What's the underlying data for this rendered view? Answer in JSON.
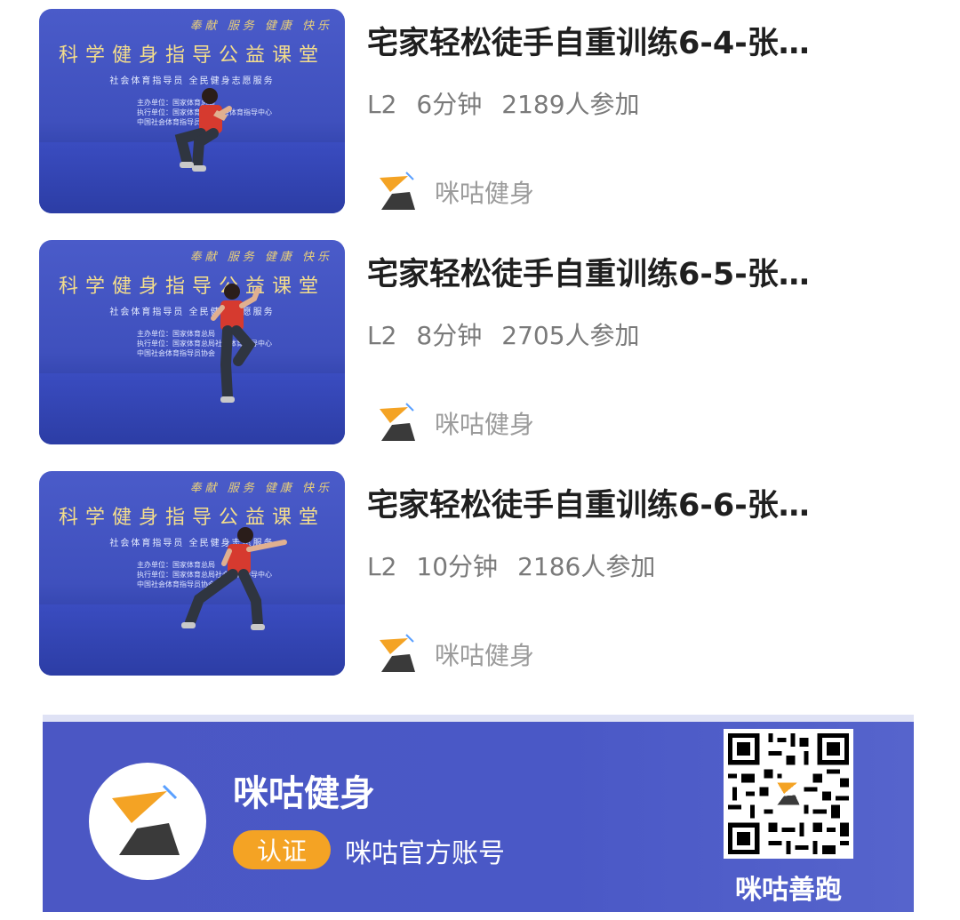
{
  "courses": [
    {
      "title": "宅家轻松徒手自重训练6-4-张…",
      "level": "L2",
      "duration": "6分钟",
      "participants": "2189人参加",
      "source": "咪咕健身",
      "thumb": {
        "motto": "奉献 服务 健康 快乐",
        "banner": "科学健身指导公益课堂",
        "sub": "社会体育指导员 全民健身志愿服务",
        "info": [
          "主办单位：国家体育总局",
          "执行单位：国家体育总局社会体育指导中心",
          "中国社会体育指导员协会"
        ],
        "pose": "squat"
      }
    },
    {
      "title": "宅家轻松徒手自重训练6-5-张…",
      "level": "L2",
      "duration": "8分钟",
      "participants": "2705人参加",
      "source": "咪咕健身",
      "thumb": {
        "motto": "奉献 服务 健康 快乐",
        "banner": "科学健身指导公益课堂",
        "sub": "社会体育指导员 全民健身志愿服务",
        "info": [
          "主办单位：国家体育总局",
          "执行单位：国家体育总局社会体育指导中心",
          "中国社会体育指导员协会"
        ],
        "pose": "knee-raise"
      }
    },
    {
      "title": "宅家轻松徒手自重训练6-6-张…",
      "level": "L2",
      "duration": "10分钟",
      "participants": "2186人参加",
      "source": "咪咕健身",
      "thumb": {
        "motto": "奉献 服务 健康 快乐",
        "banner": "科学健身指导公益课堂",
        "sub": "社会体育指导员 全民健身志愿服务",
        "info": [
          "主办单位：国家体育总局",
          "执行单位：国家体育总局社会体育指导中心",
          "中国社会体育指导员协会"
        ],
        "pose": "lunge-punch"
      }
    }
  ],
  "account_card": {
    "name": "咪咕健身",
    "badge": "认证",
    "verified_text": "咪咕官方账号",
    "qr_caption": "咪咕善跑"
  },
  "colors": {
    "brand_orange": "#f4a324",
    "brand_dark": "#3a3a3a",
    "card_blue": "#4b57c4",
    "title_text": "#1f1f1f",
    "meta_text": "#7a7a7a"
  },
  "icons": {
    "source_logo": "migu-fitness-logo",
    "qr": "qr-code"
  }
}
